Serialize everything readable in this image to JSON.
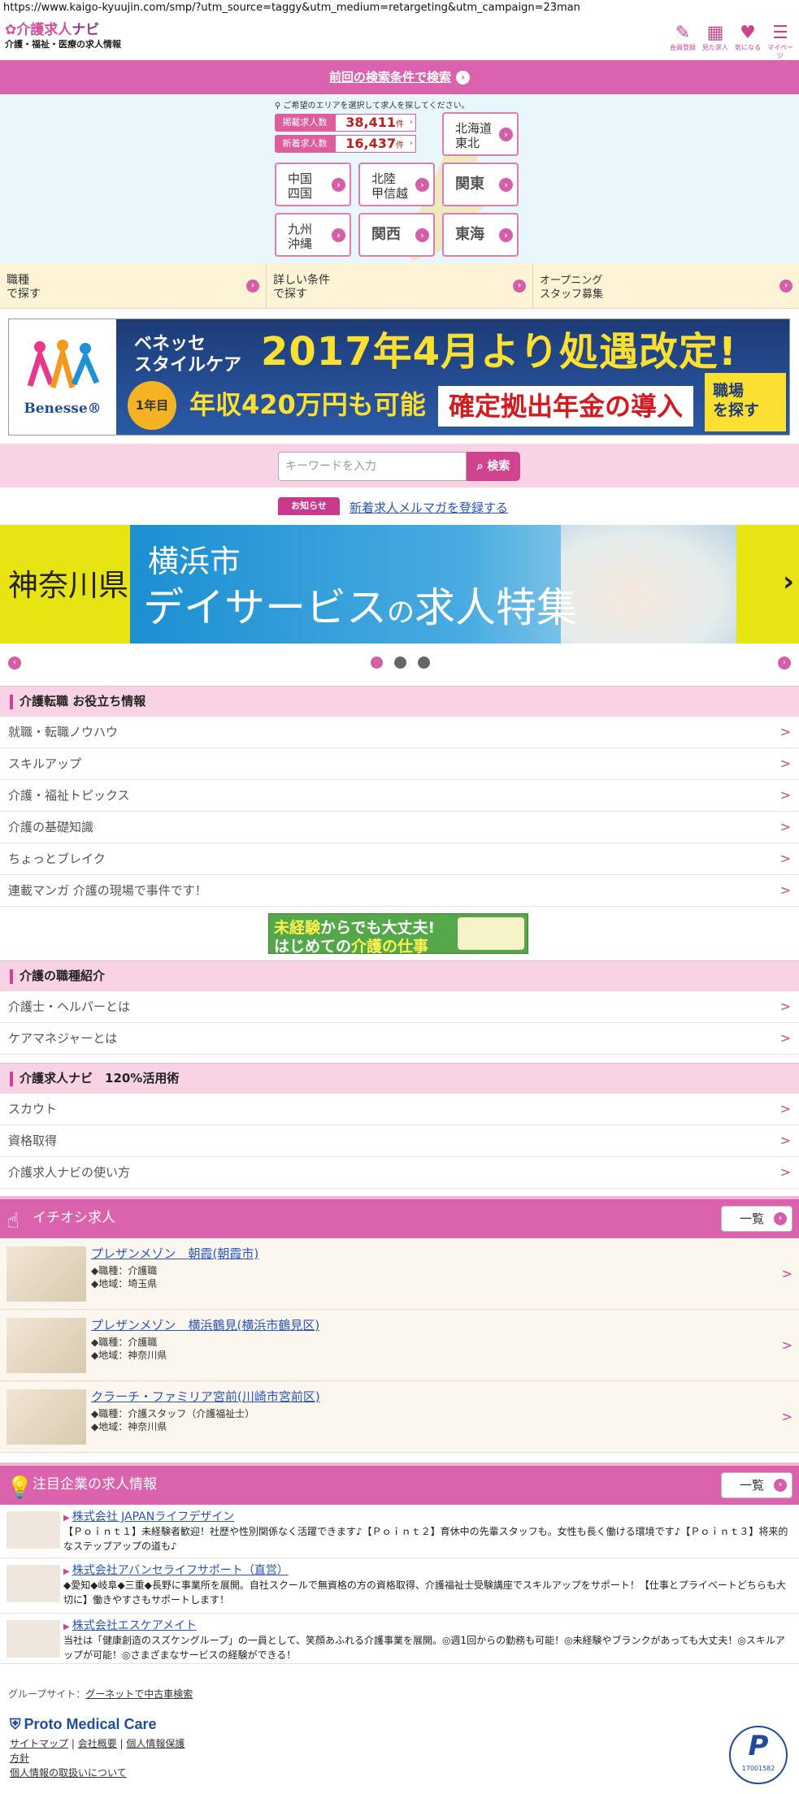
{
  "browser": {
    "url": "https://www.kaigo-kyuujin.com/smp/?utm_source=taggy&utm_medium=retargeting&utm_campaign=23man"
  },
  "header": {
    "logo_main_a": "介護求人",
    "logo_main_b": "ナビ",
    "logo_sub": "介護・福祉・医療の求人情報",
    "icons": [
      {
        "icon": "pencil-icon",
        "label": "会員登録",
        "glyph": "✎"
      },
      {
        "icon": "calendar-icon",
        "label": "見た求人",
        "glyph": "▦"
      },
      {
        "icon": "heart-icon",
        "label": "気になる",
        "glyph": "♥"
      },
      {
        "icon": "mypage-icon",
        "label": "マイページ",
        "glyph": "☰"
      }
    ]
  },
  "prev_search": {
    "label": "前回の検索条件で検索"
  },
  "area": {
    "note": "ご希望のエリアを選択して求人を探してください。",
    "stats": [
      {
        "label": "掲載求人数",
        "value": "38,411",
        "unit": "件"
      },
      {
        "label": "新着求人数",
        "value": "16,437",
        "unit": "件"
      }
    ],
    "regions": {
      "hokkaido": [
        "北海道",
        "東北"
      ],
      "chugoku": [
        "中国",
        "四国"
      ],
      "hokuriku": [
        "北陸",
        "甲信越"
      ],
      "kanto": "関東",
      "kyushu": [
        "九州",
        "沖縄"
      ],
      "kansai": "関西",
      "tokai": "東海"
    }
  },
  "search_tabs": [
    [
      "職種",
      "で探す"
    ],
    [
      "詳しい条件",
      "で探す"
    ],
    [
      "オープニング",
      "スタッフ募集"
    ]
  ],
  "banner1": {
    "brand": "Benesse®",
    "sub": [
      "ベネッセ",
      "スタイルケア"
    ],
    "headline": "2017年4月より処遇改定!",
    "badge": "1年目",
    "salary": "年収420万円も可能",
    "pension": "確定拠出年金の導入",
    "cta": [
      "職場",
      "を探す"
    ]
  },
  "search": {
    "placeholder": "キーワードを入力",
    "button": "検索"
  },
  "notice": {
    "tag": "お知らせ",
    "link": "新着求人メルマガを登録する"
  },
  "banner2": {
    "pref": "神奈川県",
    "city": "横浜市",
    "title_a": "デイサービス",
    "title_b": "の",
    "title_c": "求人特集"
  },
  "carousel": {
    "dots": 3,
    "active": 0
  },
  "sections": {
    "useful": {
      "title": "介護転職 お役立ち情報",
      "items": [
        "就職・転職ノウハウ",
        "スキルアップ",
        "介護・福祉トピックス",
        "介護の基礎知識",
        "ちょっとブレイク",
        "連載マンガ 介護の現場で事件です！"
      ]
    },
    "mid_banner": {
      "line1_a": "未経験",
      "line1_b": "からでも大丈夫!",
      "line2_a": "はじめての",
      "line2_b": "介護の仕事"
    },
    "jobtypes": {
      "title": "介護の職種紹介",
      "items": [
        "介護士・ヘルパーとは",
        "ケアマネジャーとは"
      ]
    },
    "usage": {
      "title": "介護求人ナビ　120%活用術",
      "items": [
        "スカウト",
        "資格取得",
        "介護求人ナビの使い方"
      ]
    }
  },
  "featured": {
    "title": "イチオシ求人",
    "more": "一覧",
    "jobs": [
      {
        "title": "プレザンメゾン　朝霞(朝霞市)",
        "job": "◆職種：介護職",
        "area": "◆地域：埼玉県"
      },
      {
        "title": "プレザンメゾン　横浜鶴見(横浜市鶴見区)",
        "job": "◆職種：介護職",
        "area": "◆地域：神奈川県"
      },
      {
        "title": "クラーチ・ファミリア宮前(川崎市宮前区)",
        "job": "◆職種：介護スタッフ（介護福祉士）",
        "area": "◆地域：神奈川県"
      }
    ]
  },
  "companies": {
    "title": "注目企業の求人情報",
    "more": "一覧",
    "items": [
      {
        "name": "株式会社 JAPANライフデザイン",
        "desc": "【Ｐｏｉｎｔ１】未経験者歓迎！社歴や性別関係なく活躍できます♪【Ｐｏｉｎｔ２】育休中の先輩スタッフも。女性も長く働ける環境です♪【Ｐｏｉｎｔ３】将来的なステップアップの道も♪"
      },
      {
        "name": "株式会社アバンセライフサポート（直営）",
        "desc": "◆愛知◆岐阜◆三重◆長野に事業所を展開。自社スクールで無資格の方の資格取得、介護福祉士受験講座でスキルアップをサポート！【仕事とプライベートどちらも大切に】働きやすさもサポートします！"
      },
      {
        "name": "株式会社エスケアメイト",
        "desc": "当社は「健康創造のスズケングループ」の一員として、笑顔あふれる介護事業を展開。◎週1回からの勤務も可能！◎未経験やブランクがあっても大丈夫！◎スキルアップが可能！◎さまざまなサービスの経験ができる！"
      }
    ]
  },
  "footer": {
    "group_label": "グループサイト：",
    "group_link": "グーネットで中古車検索",
    "brand": "Proto Medical Care",
    "links1": [
      "サイトマップ",
      "会社概要",
      "個人情報保護",
      "方針"
    ],
    "links2": "個人情報の取扱いについて",
    "privacy_no": "17001582"
  }
}
